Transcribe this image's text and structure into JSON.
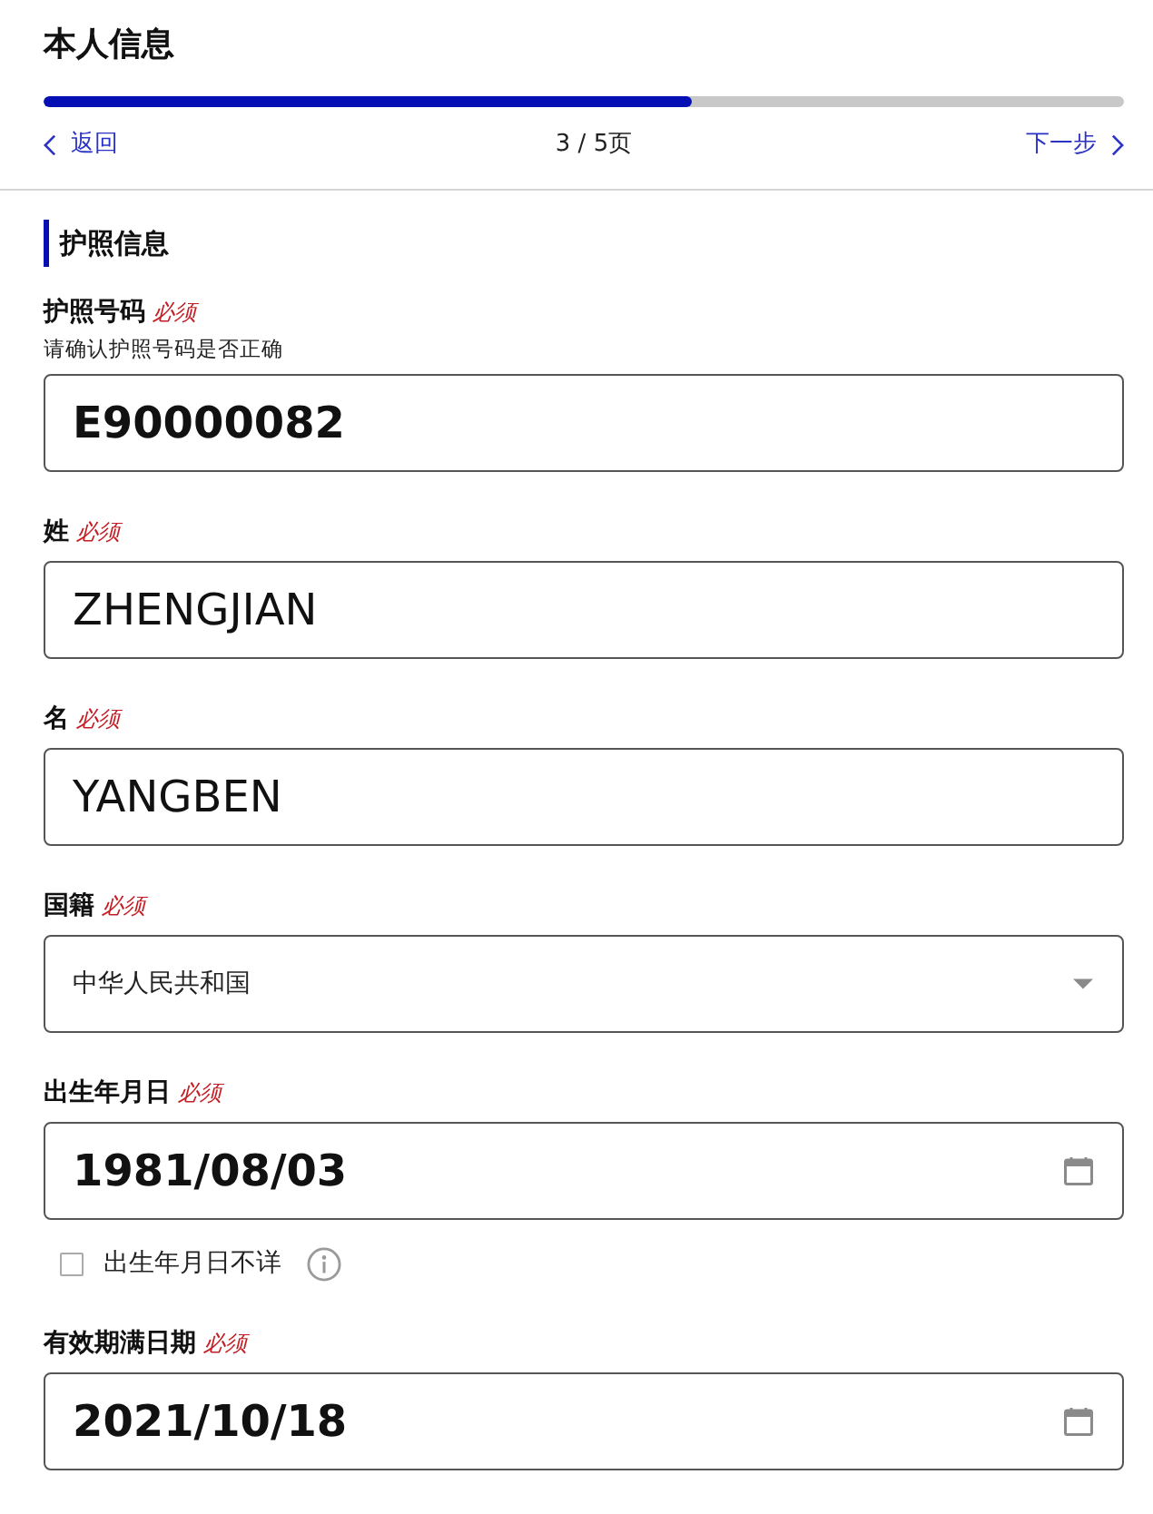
{
  "header": {
    "title": "本人信息",
    "progress": {
      "level": 0.6
    },
    "back": {
      "label": "返回"
    },
    "page_indicator": "3 / 5页",
    "next": {
      "label": "下一步"
    }
  },
  "section": {
    "title": "护照信息"
  },
  "fields": [
    {
      "kind": "code",
      "label": "护照号码",
      "required": "必须",
      "hint": "请确认护照号码是否正确",
      "value": "E90000082"
    },
    {
      "kind": "text",
      "label": "姓",
      "required": "必须",
      "value": "ZHENGJIAN"
    },
    {
      "kind": "text",
      "label": "名",
      "required": "必须",
      "value": "YANGBEN"
    },
    {
      "kind": "select",
      "label": "国籍",
      "required": "必须",
      "value": "中华人民共和国"
    },
    {
      "kind": "date",
      "label": "出生年月日",
      "required": "必须",
      "value": "1981/08/03",
      "checkbox": {
        "label": "出生年月日不详",
        "checked": false
      }
    },
    {
      "kind": "date",
      "label": "有效期满日期",
      "required": "必须",
      "value": "2021/10/18"
    }
  ]
}
